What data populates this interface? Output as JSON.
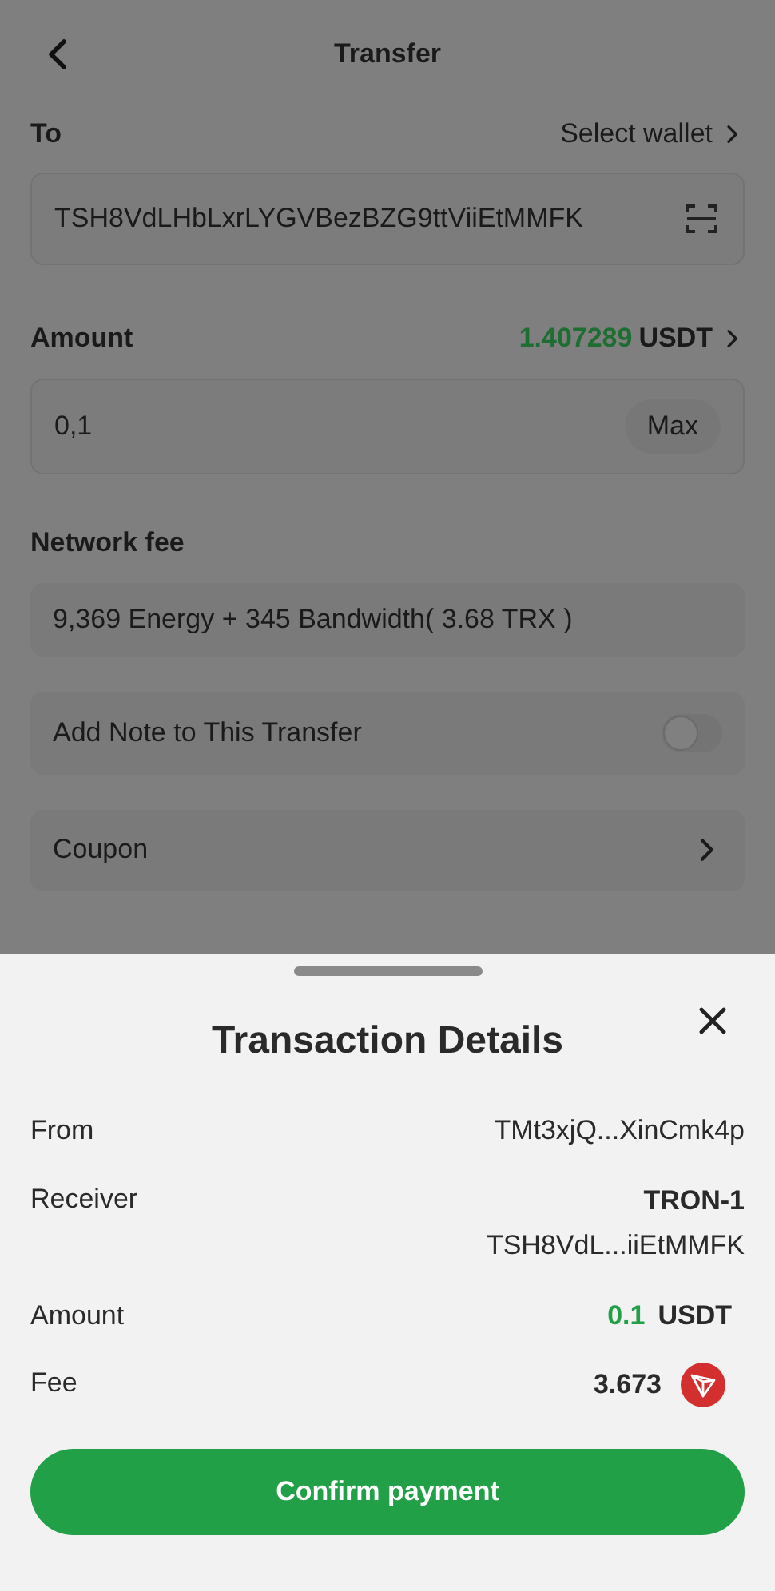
{
  "header": {
    "title": "Transfer"
  },
  "to": {
    "label": "To",
    "link": "Select wallet",
    "value": "TSH8VdLHbLxrLYGVBezBZG9ttViiEtMMFK"
  },
  "amount": {
    "label": "Amount",
    "balance": "1.407289",
    "unit": "USDT",
    "value": "0,1",
    "max": "Max"
  },
  "network_fee": {
    "label": "Network fee",
    "value": "9,369 Energy +  345 Bandwidth( 3.68 TRX )"
  },
  "note": {
    "label": "Add Note to This Transfer",
    "on": false
  },
  "coupon": {
    "label": "Coupon"
  },
  "sheet": {
    "title": "Transaction Details",
    "rows": [
      {
        "kind": "text",
        "label": "From",
        "value": "TMt3xjQ...XinCmk4p"
      },
      {
        "kind": "receiver",
        "label": "Receiver",
        "name": "TRON-1",
        "value": "TSH8VdL...iiEtMMFK"
      },
      {
        "kind": "amount",
        "label": "Amount",
        "value": "0.1",
        "unit": "USDT"
      },
      {
        "kind": "fee",
        "label": "Fee",
        "value": "3.673"
      }
    ],
    "confirm": "Confirm payment"
  }
}
